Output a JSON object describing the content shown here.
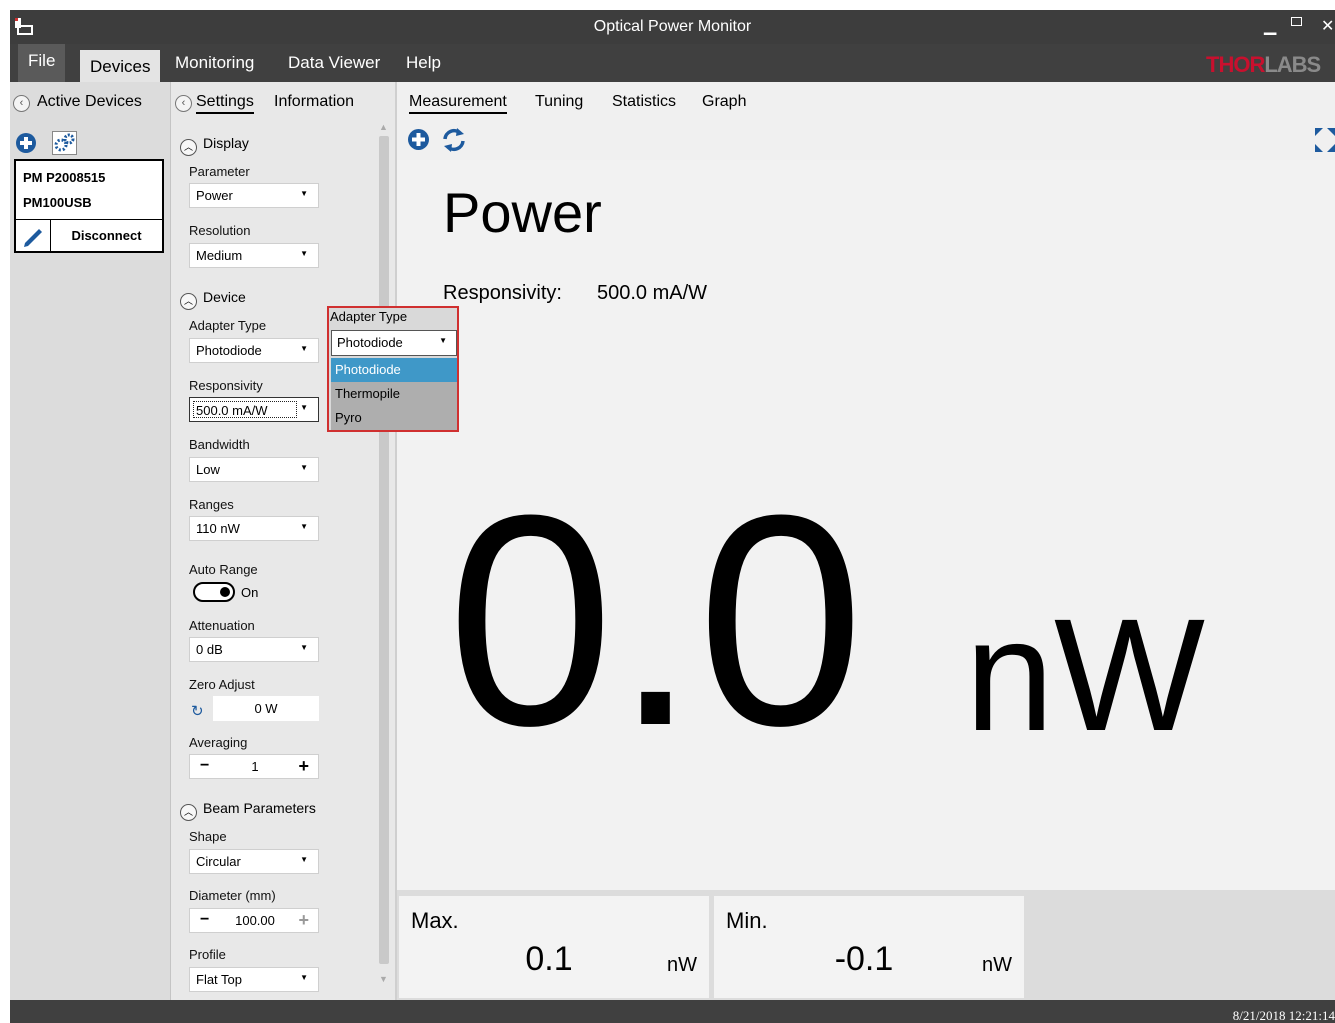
{
  "window": {
    "title": "Optical Power Monitor"
  },
  "menu": {
    "items": [
      "File",
      "Devices",
      "Monitoring",
      "Data Viewer",
      "Help"
    ]
  },
  "logo": {
    "prefix": "THOR",
    "suffix": "LABS"
  },
  "left_panel": {
    "tab": "Active Devices",
    "device": {
      "line1": "PM P2008515",
      "line2": "PM100USB",
      "disconnect_label": "Disconnect"
    }
  },
  "settings": {
    "tabs": [
      "Settings",
      "Information"
    ],
    "sections": {
      "display": "Display",
      "device": "Device",
      "beam": "Beam Parameters"
    },
    "parameter": {
      "label": "Parameter",
      "value": "Power"
    },
    "resolution": {
      "label": "Resolution",
      "value": "Medium"
    },
    "adapter": {
      "label": "Adapter Type",
      "value": "Photodiode"
    },
    "responsivity": {
      "label": "Responsivity",
      "value": "500.0 mA/W"
    },
    "bandwidth": {
      "label": "Bandwidth",
      "value": "Low"
    },
    "ranges": {
      "label": "Ranges",
      "value": "110 nW"
    },
    "auto_range": {
      "label": "Auto Range",
      "state": "On"
    },
    "attenuation": {
      "label": "Attenuation",
      "value": "0 dB"
    },
    "zero_adjust": {
      "label": "Zero Adjust",
      "value": "0 W"
    },
    "averaging": {
      "label": "Averaging",
      "value": "1"
    },
    "shape": {
      "label": "Shape",
      "value": "Circular"
    },
    "diameter": {
      "label": "Diameter (mm)",
      "value": "100.00"
    },
    "profile": {
      "label": "Profile",
      "value": "Flat Top"
    }
  },
  "popup": {
    "label": "Adapter Type",
    "selected": "Photodiode",
    "options": [
      "Photodiode",
      "Thermopile",
      "Pyro"
    ]
  },
  "main": {
    "tabs": [
      "Measurement",
      "Tuning",
      "Statistics",
      "Graph"
    ],
    "title": "Power",
    "responsivity_label": "Responsivity:",
    "responsivity_value": "500.0 mA/W",
    "value": "0.0",
    "unit": "nW",
    "max": {
      "label": "Max.",
      "value": "0.1",
      "unit": "nW"
    },
    "min": {
      "label": "Min.",
      "value": "-0.1",
      "unit": "nW"
    }
  },
  "status": {
    "time": "8/21/2018 12:21:14"
  },
  "colors": {
    "accent_blue": "#1d5a9e",
    "highlight": "#3f98c8",
    "popup_border": "#d03030"
  }
}
